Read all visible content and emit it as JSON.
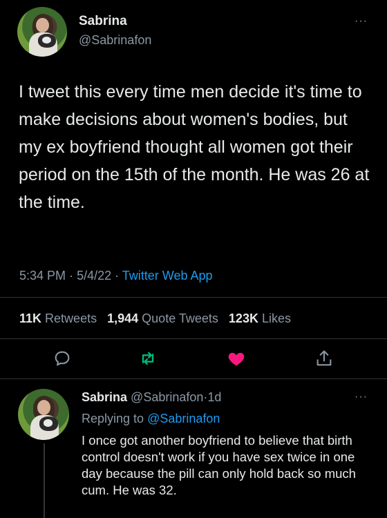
{
  "tweet": {
    "author_name": "Sabrina",
    "author_handle": "@Sabrinafon",
    "text": "I tweet this every time men decide it's time to make decisions about women's bodies, but my ex boyfriend thought all women got their period on the 15th of the month. He was 26 at the time.",
    "time": "5:34 PM",
    "date": "5/4/22",
    "source": "Twitter Web App",
    "more_icon": "more-dots-icon"
  },
  "stats": {
    "retweets_count": "11K",
    "retweets_label": "Retweets",
    "quotes_count": "1,944",
    "quotes_label": "Quote Tweets",
    "likes_count": "123K",
    "likes_label": "Likes"
  },
  "actions": {
    "reply_icon": "reply-icon",
    "retweet_icon": "retweet-icon",
    "like_icon": "heart-icon",
    "share_icon": "share-icon",
    "retweet_color": "#00ba7c",
    "like_color": "#f91880"
  },
  "reply": {
    "author_name": "Sabrina",
    "author_handle": "@Sabrinafon",
    "age": "1d",
    "replying_prefix": "Replying to",
    "replying_to": "@Sabrinafon",
    "text": "I once got another boyfriend to believe that birth control doesn't work if you have sex twice in one day because the pill can only hold back so much cum. He was 32."
  },
  "colors": {
    "background": "#000000",
    "text": "#e7e9ea",
    "secondary": "#8b98a5",
    "accent": "#1d9bf0"
  }
}
